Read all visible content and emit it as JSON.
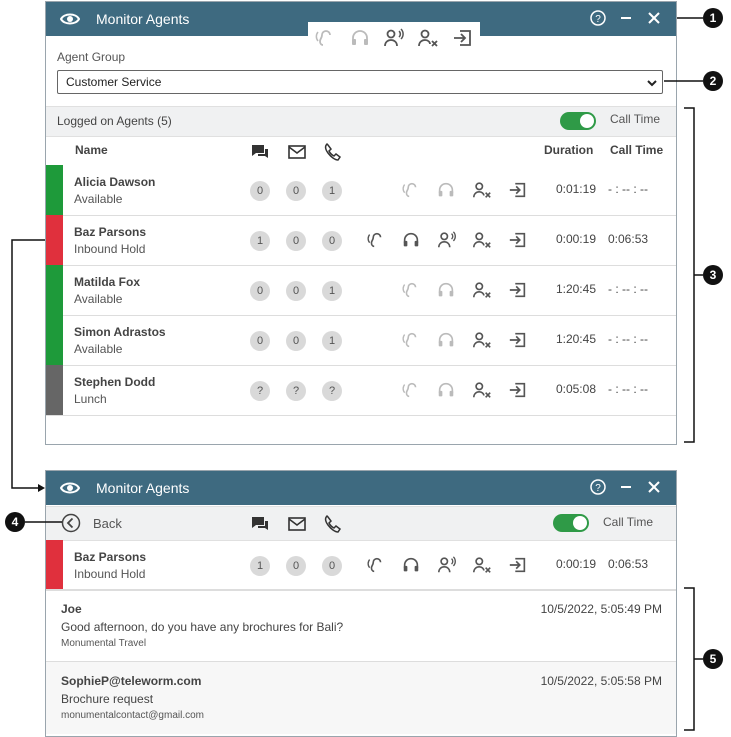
{
  "window1": {
    "title": "Monitor Agents",
    "agent_group_label": "Agent Group",
    "agent_group_value": "Customer Service",
    "logged_on_label": "Logged on Agents (5)",
    "call_time_toggle_label": "Call Time",
    "call_time_toggle_on": true,
    "columns": {
      "name": "Name",
      "duration": "Duration",
      "call_time": "Call Time"
    },
    "agents": [
      {
        "name": "Alicia Dawson",
        "status": "Available",
        "color": "#1e9a3a",
        "chats": "0",
        "emails": "0",
        "calls": "1",
        "call_icons_active": false,
        "duration": "0:01:19",
        "call_time": "- : -- : --"
      },
      {
        "name": "Baz Parsons",
        "status": "Inbound Hold",
        "color": "#e0303d",
        "chats": "1",
        "emails": "0",
        "calls": "0",
        "call_icons_active": true,
        "duration": "0:00:19",
        "call_time": "0:06:53"
      },
      {
        "name": "Matilda Fox",
        "status": "Available",
        "color": "#1e9a3a",
        "chats": "0",
        "emails": "0",
        "calls": "1",
        "call_icons_active": false,
        "duration": "1:20:45",
        "call_time": "- : -- : --"
      },
      {
        "name": "Simon Adrastos",
        "status": "Available",
        "color": "#1e9a3a",
        "chats": "0",
        "emails": "0",
        "calls": "1",
        "call_icons_active": false,
        "duration": "1:20:45",
        "call_time": "- : -- : --"
      },
      {
        "name": "Stephen Dodd",
        "status": "Lunch",
        "color": "#666666",
        "chats": "?",
        "emails": "?",
        "calls": "?",
        "call_icons_active": false,
        "duration": "0:05:08",
        "call_time": "- : -- : --"
      }
    ]
  },
  "window2": {
    "title": "Monitor Agents",
    "back_label": "Back",
    "call_time_toggle_label": "Call Time",
    "agent": {
      "name": "Baz Parsons",
      "status": "Inbound Hold",
      "color": "#e0303d",
      "chats": "1",
      "emails": "0",
      "calls": "0",
      "duration": "0:00:19",
      "call_time": "0:06:53"
    },
    "messages": [
      {
        "from": "Joe",
        "time": "10/5/2022, 5:05:49 PM",
        "text": "Good afternoon, do you have any brochures for Bali?",
        "sub": "Monumental Travel"
      },
      {
        "from": "SophieP@teleworm.com",
        "time": "10/5/2022, 5:05:58 PM",
        "text": "Brochure request",
        "sub": "monumentalcontact@gmail.com"
      }
    ]
  },
  "callouts": [
    "1",
    "2",
    "3",
    "4",
    "5"
  ],
  "colors": {
    "titlebar": "#3e6a80",
    "toggle_on": "#2f9a47",
    "available": "#1e9a3a",
    "hold": "#e0303d",
    "away": "#666666"
  },
  "icons": [
    "eye-icon",
    "help-icon",
    "minimize-icon",
    "close-icon",
    "listen-icon",
    "headset-icon",
    "barge-icon",
    "logout-agent-icon",
    "transfer-icon",
    "chat-icon",
    "email-icon",
    "phone-icon",
    "back-icon",
    "chevron-down-icon"
  ]
}
